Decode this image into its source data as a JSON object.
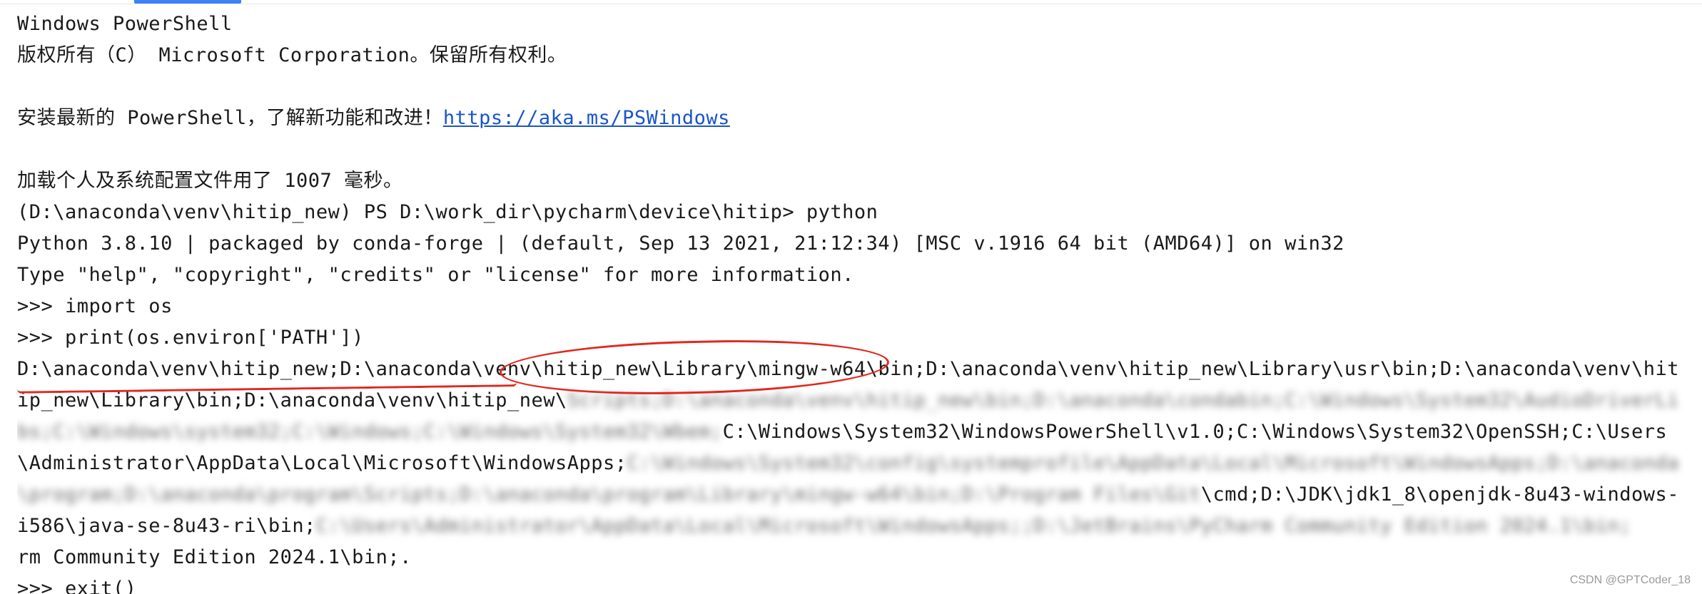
{
  "terminal": {
    "header_line": "Windows PowerShell",
    "copyright_line": "版权所有（C） Microsoft Corporation。保留所有权利。",
    "install_prefix": "安装最新的 PowerShell，了解新功能和改进！",
    "install_link": "https://aka.ms/PSWindows",
    "profile_load_line": "加载个人及系统配置文件用了 1007 毫秒。",
    "prompt_line": "(D:\\anaconda\\venv\\hitip_new) PS D:\\work_dir\\pycharm\\device\\hitip> python",
    "python_version_line": "Python 3.8.10 | packaged by conda-forge | (default, Sep 13 2021, 21:12:34) [MSC v.1916 64 bit (AMD64)] on win32",
    "python_help_line": "Type \"help\", \"copyright\", \"credits\" or \"license\" for more information.",
    "cmd_import": ">>> import os",
    "cmd_print": ">>> print(os.environ['PATH'])",
    "path_visible_1": "D:\\anaconda\\venv\\hitip_new;D:\\anaconda\\venv\\hitip_new\\Library\\mingw-w64\\bin;D:\\anaconda\\venv\\hitip_new\\Library\\usr\\bin;D:\\anaconda\\venv\\hitip_new\\Library\\bin;D:\\anaconda\\venv\\hitip_new\\",
    "path_blurred_1": "Scripts;D:\\anaconda\\venv\\hitip_new\\bin;D:\\anaconda\\condabin;C:\\Windows\\System32\\AudioDriverLibs;C:\\Windows\\system32;C:\\Windows;C:\\Windows\\System32\\Wbem;",
    "path_visible_2": "C:\\Windows\\System32\\WindowsPowerShell\\v1.0;C:\\Windows\\System32\\OpenSSH;C:\\Users\\Administrator\\AppData\\Local\\Microsoft\\WindowsApps;",
    "path_blurred_2": "C:\\Windows\\System32\\config\\systemprofile\\AppData\\Local\\Microsoft\\WindowsApps;D:\\anaconda\\program;D:\\anaconda\\program\\Scripts;D:\\anaconda\\program\\Library\\mingw-w64\\bin;D:\\Program Files\\Git",
    "path_visible_3": "\\cmd;D:\\JDK\\jdk1_8\\openjdk-8u43-windows-i586\\java-se-8u43-ri\\bin;",
    "path_blurred_3": "C:\\Users\\Administrator\\AppData\\Local\\Microsoft\\WindowsApps;;D:\\JetBrains\\PyCharm Community Edition 2024.1\\bin;",
    "path_visible_4": "rm Community Edition 2024.1\\bin;.",
    "cmd_exit": ">>> exit()"
  },
  "watermark": "CSDN @GPTCoder_18",
  "colors": {
    "background": "#ffffff",
    "text": "#1a1a1a",
    "link": "#1a55c8",
    "annotation": "#e0281e",
    "tab_indicator": "#3c82f6"
  }
}
